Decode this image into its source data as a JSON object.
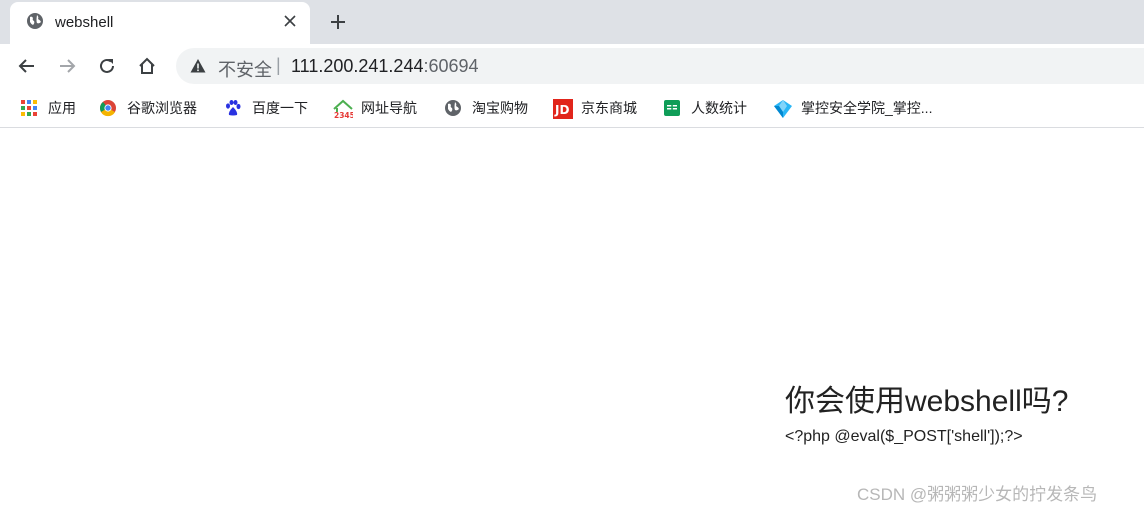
{
  "tab": {
    "title": "webshell"
  },
  "address_bar": {
    "security_label": "不安全",
    "separator": "|",
    "url_host": "111.200.241.244",
    "url_port": ":60694"
  },
  "bookmarks": [
    {
      "label": "应用",
      "icon": "apps-grid-icon"
    },
    {
      "label": "谷歌浏览器",
      "icon": "chrome-icon"
    },
    {
      "label": "百度一下",
      "icon": "baidu-paw-icon"
    },
    {
      "label": "网址导航",
      "icon": "2345-house-icon"
    },
    {
      "label": "淘宝购物",
      "icon": "globe-icon"
    },
    {
      "label": "京东商城",
      "icon": "jd-logo-icon"
    },
    {
      "label": "人数统计",
      "icon": "sheet-icon"
    },
    {
      "label": "掌控安全学院_掌控...",
      "icon": "zkaq-logo-icon"
    }
  ],
  "page": {
    "heading": "你会使用webshell吗?",
    "code": "<?php @eval($_POST['shell']);?>"
  },
  "watermark": "CSDN @粥粥粥少女的拧发条鸟",
  "colors": {
    "tabstrip_bg": "#dee1e6",
    "omnibox_bg": "#f1f3f4",
    "text": "#202124",
    "muted": "#5f6368"
  }
}
